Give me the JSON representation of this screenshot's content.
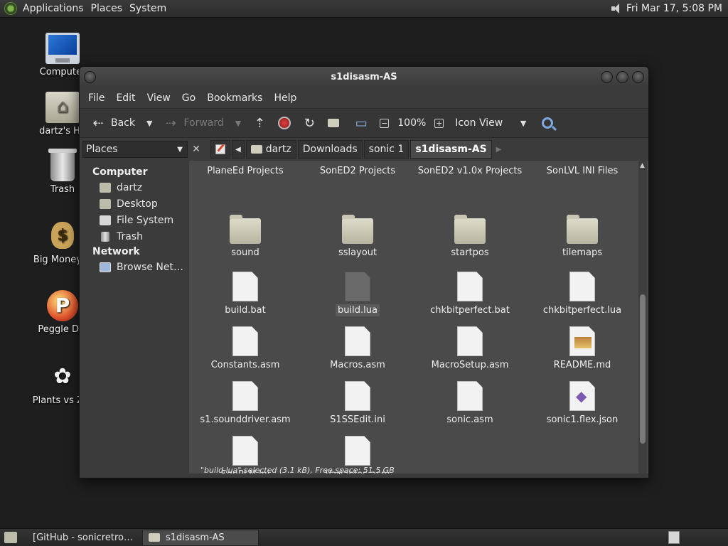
{
  "top_panel": {
    "menus": [
      "Applications",
      "Places",
      "System"
    ],
    "clock": "Fri Mar 17,  5:08 PM"
  },
  "desktop": {
    "icons": [
      {
        "label": "Computer",
        "icon": "computer-icon"
      },
      {
        "label": "dartz's Ho",
        "icon": "home-folder-icon"
      },
      {
        "label": "Trash",
        "icon": "trash-icon"
      },
      {
        "label": "Big Money D",
        "icon": "money-bag-icon"
      },
      {
        "label": "Peggle Del",
        "icon": "peggle-icon"
      },
      {
        "label": "Plants vs Zor",
        "icon": "plants-vs-zombies-icon"
      }
    ]
  },
  "window": {
    "title": "s1disasm-AS",
    "menus": [
      "File",
      "Edit",
      "View",
      "Go",
      "Bookmarks",
      "Help"
    ],
    "toolbar": {
      "back": "Back",
      "forward": "Forward",
      "zoom": "100%",
      "view_mode": "Icon View"
    },
    "sidebar_title": "Places",
    "breadcrumbs": [
      "dartz",
      "Downloads",
      "sonic 1",
      "s1disasm-AS"
    ],
    "sidebar": {
      "computer_heading": "Computer",
      "computer_items": [
        "dartz",
        "Desktop",
        "File System",
        "Trash"
      ],
      "network_heading": "Network",
      "network_items": [
        "Browse Net…"
      ]
    },
    "files": [
      {
        "name": "PlaneEd Projects",
        "type": "header"
      },
      {
        "name": "SonED2 Projects",
        "type": "header"
      },
      {
        "name": "SonED2 v1.0x Projects",
        "type": "header"
      },
      {
        "name": "SonLVL INI Files",
        "type": "header"
      },
      {
        "name": "sound",
        "type": "folder"
      },
      {
        "name": "sslayout",
        "type": "folder"
      },
      {
        "name": "startpos",
        "type": "folder"
      },
      {
        "name": "tilemaps",
        "type": "folder"
      },
      {
        "name": "build.bat",
        "type": "file"
      },
      {
        "name": "build.lua",
        "type": "file-selected"
      },
      {
        "name": "chkbitperfect.bat",
        "type": "file"
      },
      {
        "name": "chkbitperfect.lua",
        "type": "file"
      },
      {
        "name": "Constants.asm",
        "type": "file"
      },
      {
        "name": "Macros.asm",
        "type": "file"
      },
      {
        "name": "MacroSetup.asm",
        "type": "file"
      },
      {
        "name": "README.md",
        "type": "file-readme"
      },
      {
        "name": "s1.sounddriver.asm",
        "type": "file"
      },
      {
        "name": "S1SSEdit.ini",
        "type": "file"
      },
      {
        "name": "sonic.asm",
        "type": "file"
      },
      {
        "name": "sonic1.flex.json",
        "type": "file-json"
      },
      {
        "name": "SonPLN.ini",
        "type": "file"
      },
      {
        "name": "Variables.asm",
        "type": "file"
      }
    ],
    "status": "\"build.lua\" selected (3.1 kB), Free space: 51.5 GB"
  },
  "taskbar": {
    "tasks": [
      "[GitHub - sonicretro…",
      "s1disasm-AS"
    ]
  }
}
